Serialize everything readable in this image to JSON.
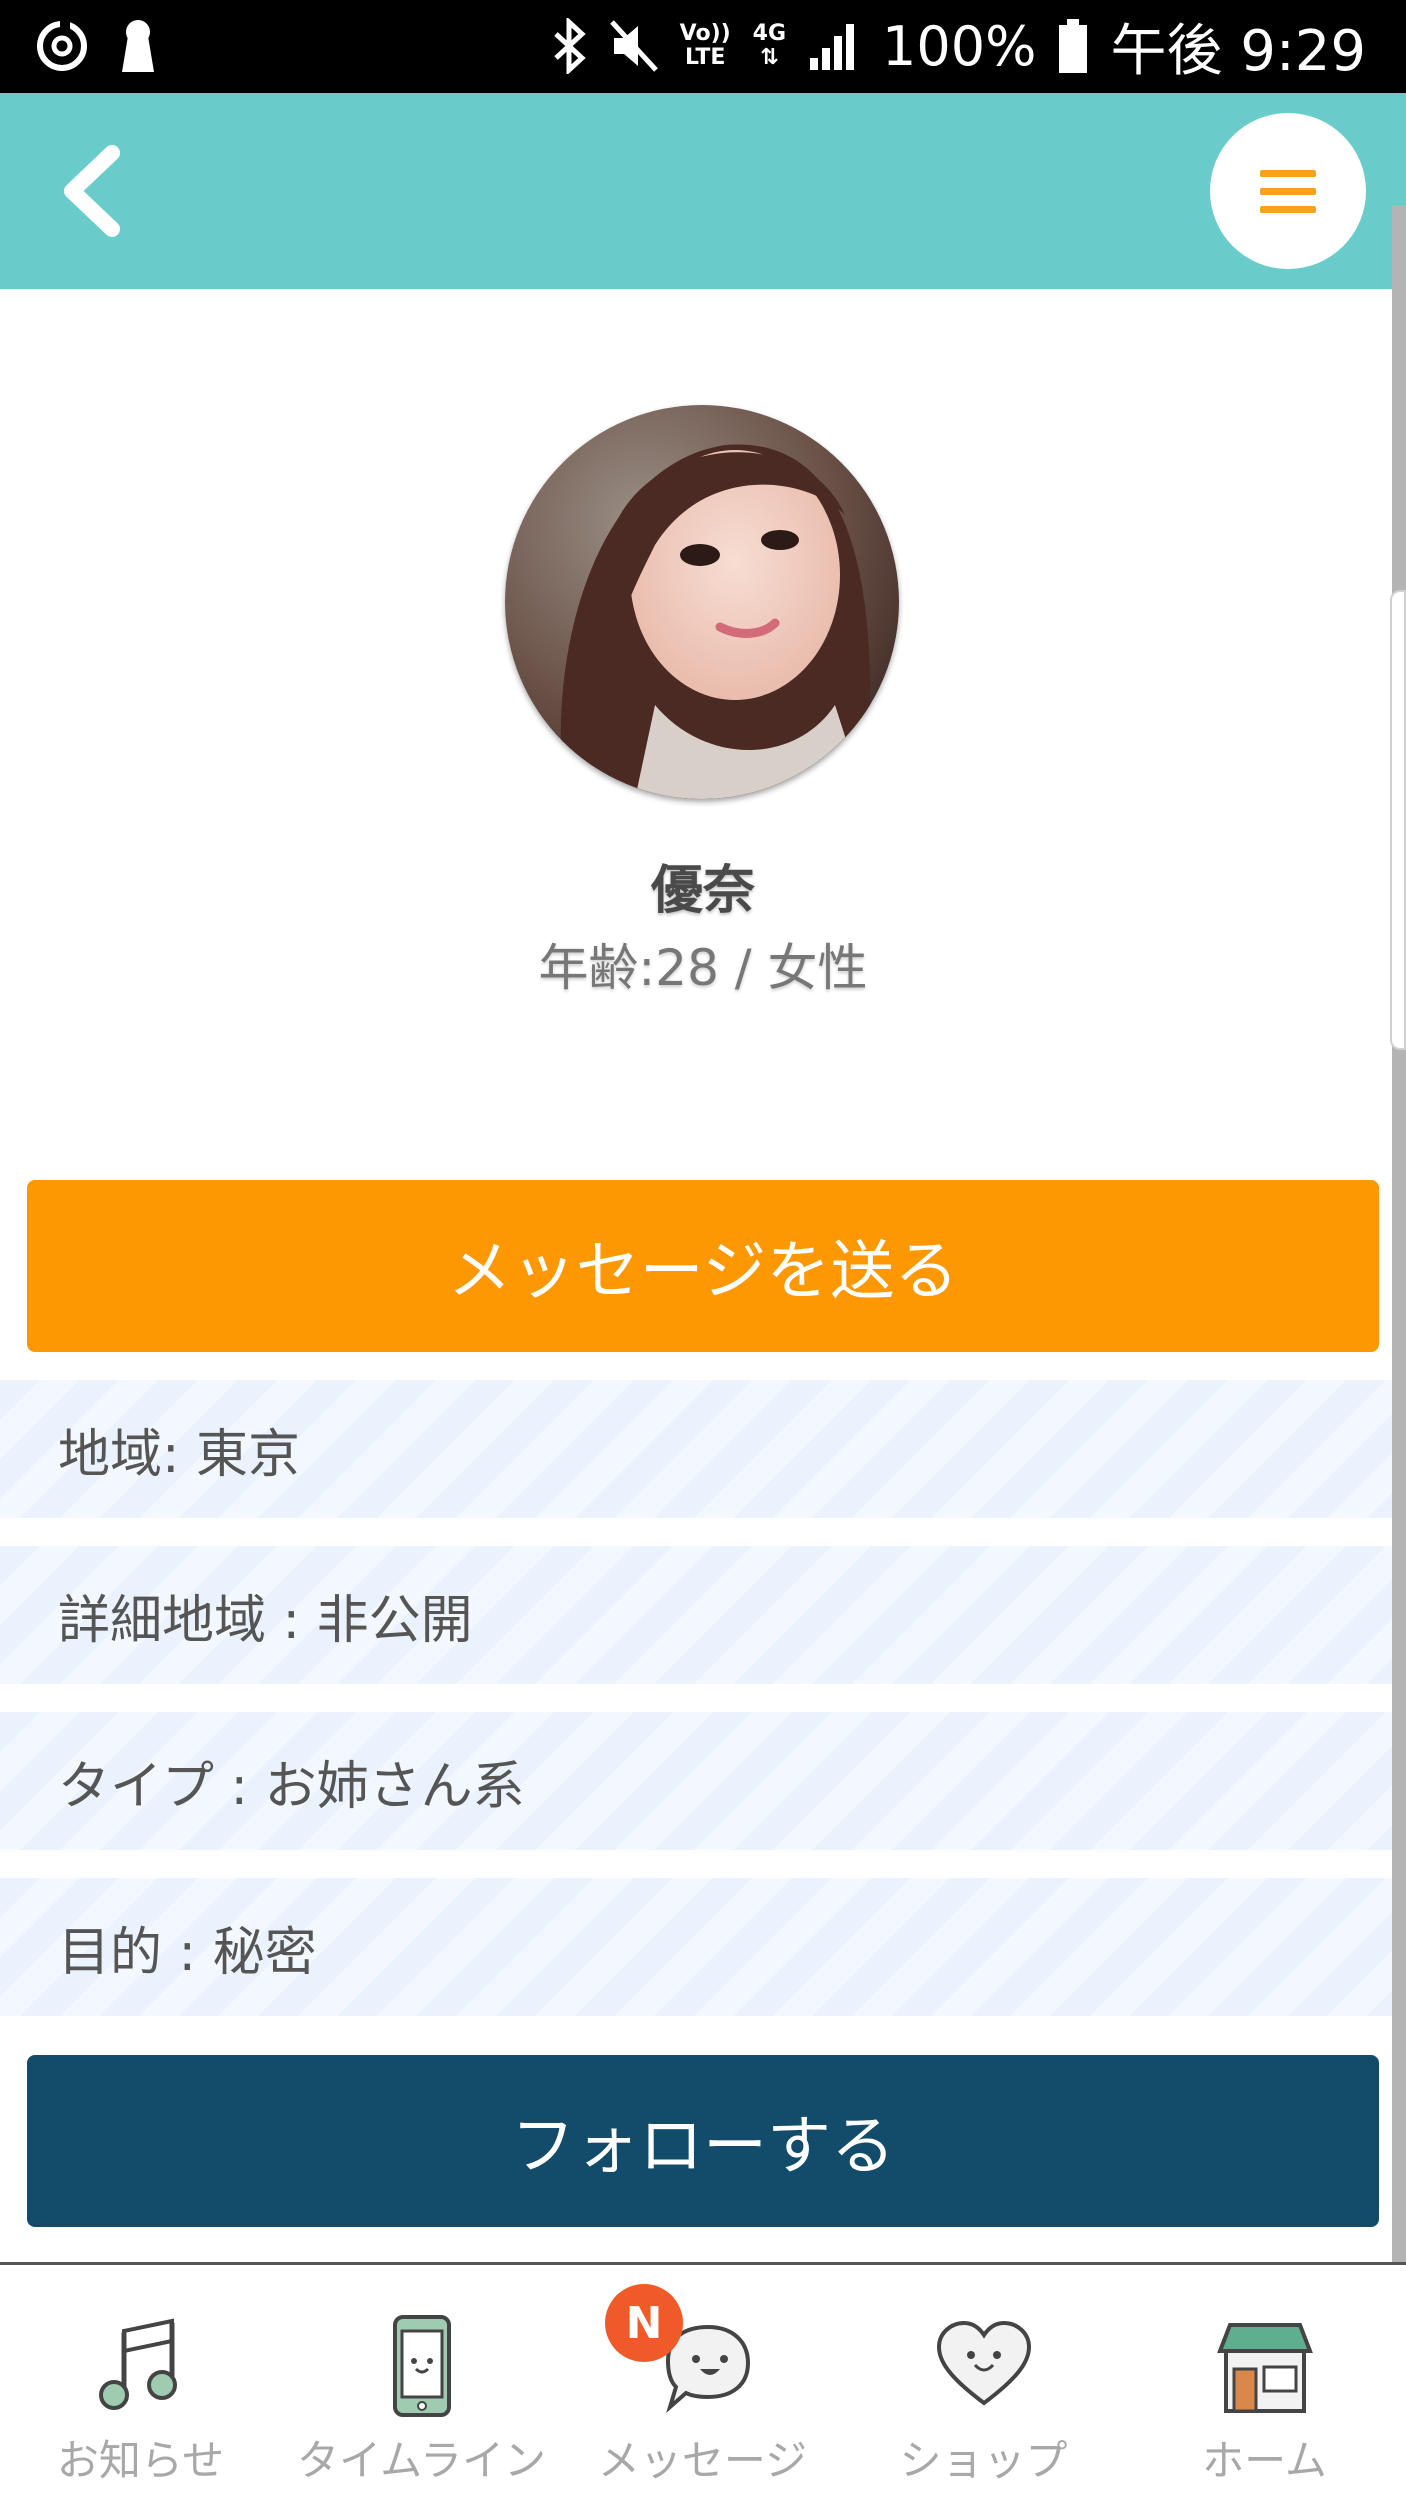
{
  "status_bar": {
    "volte_top": "Vo))",
    "volte_bottom": "LTE",
    "network": "4G",
    "battery": "100%",
    "time": "午後 9:29",
    "icons": [
      "sync-icon",
      "keyhole-icon",
      "bluetooth-icon",
      "mute-icon",
      "signal-icon",
      "battery-icon"
    ]
  },
  "header": {
    "back_icon": "chevron-left-icon",
    "menu_icon": "hamburger-menu-icon",
    "color": "#6accca",
    "menu_color": "#f7a21b"
  },
  "profile": {
    "name": "優奈",
    "meta": "年齢:28 / 女性"
  },
  "actions": {
    "message_label": "メッセージを送る",
    "follow_label": "フォローする",
    "message_color": "#fd9702",
    "follow_color": "#124c6a"
  },
  "info": [
    {
      "text": "地域: 東京"
    },
    {
      "text": "詳細地域 : 非公開"
    },
    {
      "text": "タイプ : お姉さん系"
    },
    {
      "text": "目的 : 秘密"
    }
  ],
  "nav": {
    "items": [
      {
        "label": "お知らせ",
        "icon": "music-note-icon"
      },
      {
        "label": "タイムライン",
        "icon": "smartphone-icon"
      },
      {
        "label": "メッセージ",
        "icon": "chat-bubble-icon"
      },
      {
        "label": "ショップ",
        "icon": "heart-icon"
      },
      {
        "label": "ホーム",
        "icon": "shop-icon"
      }
    ],
    "badge": "N"
  }
}
